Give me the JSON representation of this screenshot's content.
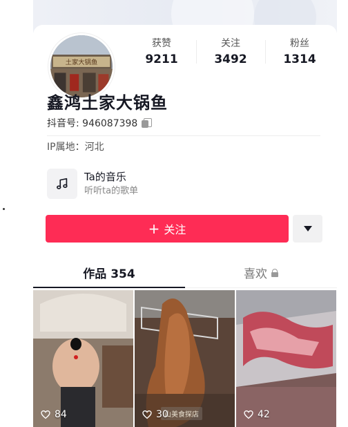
{
  "profile": {
    "avatar_sign_text": "土家大锅鱼",
    "name": "鑫鸿土家大锅鱼",
    "douyin_id": "抖音号: 946087398",
    "ip_location": "IP属地：河北"
  },
  "stats": [
    {
      "label": "获赞",
      "value": "9211"
    },
    {
      "label": "关注",
      "value": "3492"
    },
    {
      "label": "粉丝",
      "value": "1314"
    }
  ],
  "music": {
    "title": "Ta的音乐",
    "subtitle": "听听ta的歌单"
  },
  "actions": {
    "follow_plus": "+",
    "follow_label": "关注"
  },
  "tabs": [
    {
      "label": "作品 354",
      "active": true
    },
    {
      "label": "喜欢",
      "active": false
    }
  ],
  "videos": [
    {
      "likes": "84"
    },
    {
      "likes": "30",
      "watermark": "山美食探店"
    },
    {
      "likes": "42"
    }
  ],
  "colors": {
    "follow_button": "#fe2c55",
    "text_primary": "#161823"
  },
  "icons": {
    "copy": "copy-icon",
    "music": "music-note-icon",
    "more": "triangle-down-icon",
    "lock": "lock-icon",
    "heart": "heart-outline-icon"
  }
}
